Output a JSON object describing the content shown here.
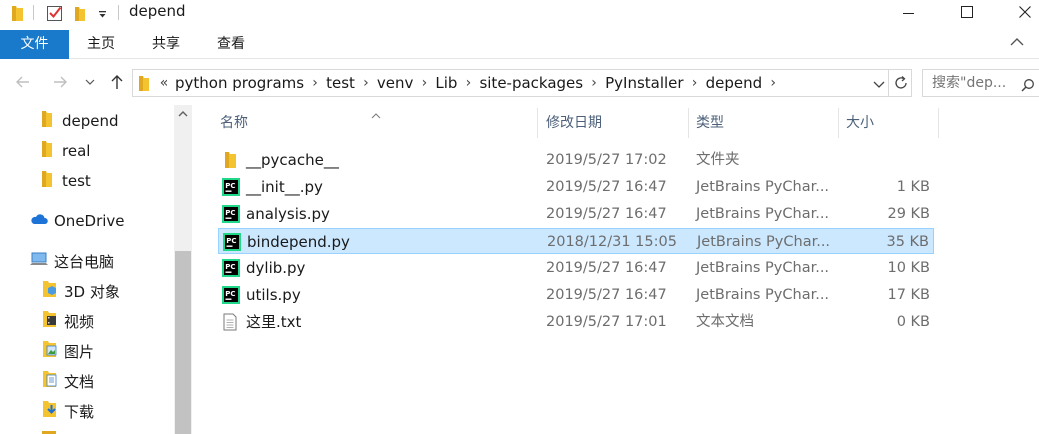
{
  "window": {
    "title": "depend",
    "quick_access_icons": [
      "folder-icon",
      "properties-check-icon",
      "new-folder-icon",
      "customize-dropdown-icon"
    ],
    "controls": [
      "minimize-icon",
      "maximize-icon",
      "close-icon"
    ]
  },
  "ribbon": {
    "tabs": [
      "文件",
      "主页",
      "共享",
      "查看"
    ],
    "active_tab": "文件",
    "accent_color": "#1979ca"
  },
  "address": {
    "overflow_marker": "«",
    "breadcrumbs": [
      "python programs",
      "test",
      "venv",
      "Lib",
      "site-packages",
      "PyInstaller",
      "depend"
    ]
  },
  "search": {
    "placeholder": "搜索\"dep..."
  },
  "sidebar": {
    "items": [
      {
        "label": "depend",
        "icon": "folder-icon"
      },
      {
        "label": "real",
        "icon": "folder-icon"
      },
      {
        "label": "test",
        "icon": "folder-icon"
      },
      {
        "label": "OneDrive",
        "icon": "onedrive-cloud-icon"
      },
      {
        "label": "这台电脑",
        "icon": "this-pc-icon"
      },
      {
        "label": "3D 对象",
        "icon": "3d-objects-icon"
      },
      {
        "label": "视频",
        "icon": "videos-icon"
      },
      {
        "label": "图片",
        "icon": "pictures-icon"
      },
      {
        "label": "文档",
        "icon": "documents-icon"
      },
      {
        "label": "下载",
        "icon": "downloads-icon"
      }
    ]
  },
  "file_list": {
    "columns": [
      "名称",
      "修改日期",
      "类型",
      "大小"
    ],
    "sorted_by": "名称",
    "rows": [
      {
        "name": "__pycache__",
        "date": "2019/5/27 17:02",
        "type": "文件夹",
        "size": "",
        "icon": "folder-icon",
        "selected": false
      },
      {
        "name": "__init__.py",
        "date": "2019/5/27 16:47",
        "type": "JetBrains PyChar...",
        "size": "1 KB",
        "icon": "pycharm-file-icon",
        "selected": false
      },
      {
        "name": "analysis.py",
        "date": "2019/5/27 16:47",
        "type": "JetBrains PyChar...",
        "size": "29 KB",
        "icon": "pycharm-file-icon",
        "selected": false
      },
      {
        "name": "bindepend.py",
        "date": "2018/12/31 15:05",
        "type": "JetBrains PyChar...",
        "size": "35 KB",
        "icon": "pycharm-file-icon",
        "selected": true
      },
      {
        "name": "dylib.py",
        "date": "2019/5/27 16:47",
        "type": "JetBrains PyChar...",
        "size": "10 KB",
        "icon": "pycharm-file-icon",
        "selected": false
      },
      {
        "name": "utils.py",
        "date": "2019/5/27 16:47",
        "type": "JetBrains PyChar...",
        "size": "17 KB",
        "icon": "pycharm-file-icon",
        "selected": false
      },
      {
        "name": "这里.txt",
        "date": "2019/5/27 17:01",
        "type": "文本文档",
        "size": "0 KB",
        "icon": "text-file-icon",
        "selected": false
      }
    ]
  },
  "colors": {
    "selection_bg": "#cce8ff",
    "selection_border": "#99d1ff",
    "folder_yellow": "#f4c430",
    "header_text": "#4c607a"
  }
}
